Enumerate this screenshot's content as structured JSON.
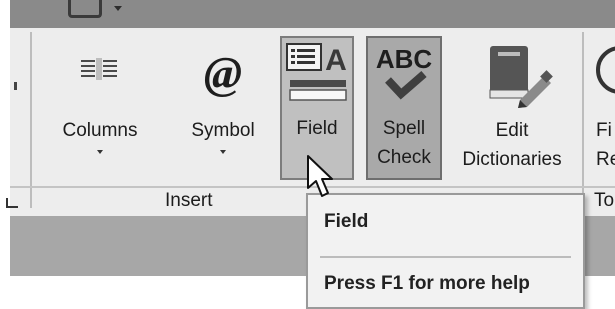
{
  "ribbon": {
    "buttons": [
      {
        "id": "columns",
        "label": "Columns",
        "has_dropdown": true,
        "icon": "columns-icon"
      },
      {
        "id": "symbol",
        "label": "Symbol",
        "has_dropdown": true,
        "icon": "at-symbol-icon"
      },
      {
        "id": "field",
        "label": "Field",
        "icon": "field-icon",
        "state": "hover"
      },
      {
        "id": "spell",
        "label_line1": "Spell",
        "label_line2": "Check",
        "icon": "spell-check-icon",
        "icon_text": "ABC",
        "state": "pressed"
      },
      {
        "id": "edit_dictionaries",
        "label_line1": "Edit",
        "label_line2": "Dictionaries",
        "icon": "dictionary-book-icon"
      },
      {
        "id": "partial_next",
        "label_line1": "Fi",
        "label_line2": "Re"
      }
    ],
    "groups": [
      {
        "label": "Insert"
      },
      {
        "label": "To"
      }
    ]
  },
  "tooltip": {
    "title": "Field",
    "help_text": "Press F1 for more help"
  },
  "colors": {
    "top_bar": "#8a8a8a",
    "ribbon_bg": "#ededed",
    "bottom_band": "#a7a7a7",
    "hover_button": "#c0c0c0",
    "pressed_button": "#a9a9a9",
    "tooltip_bg": "#f2f2f2"
  }
}
